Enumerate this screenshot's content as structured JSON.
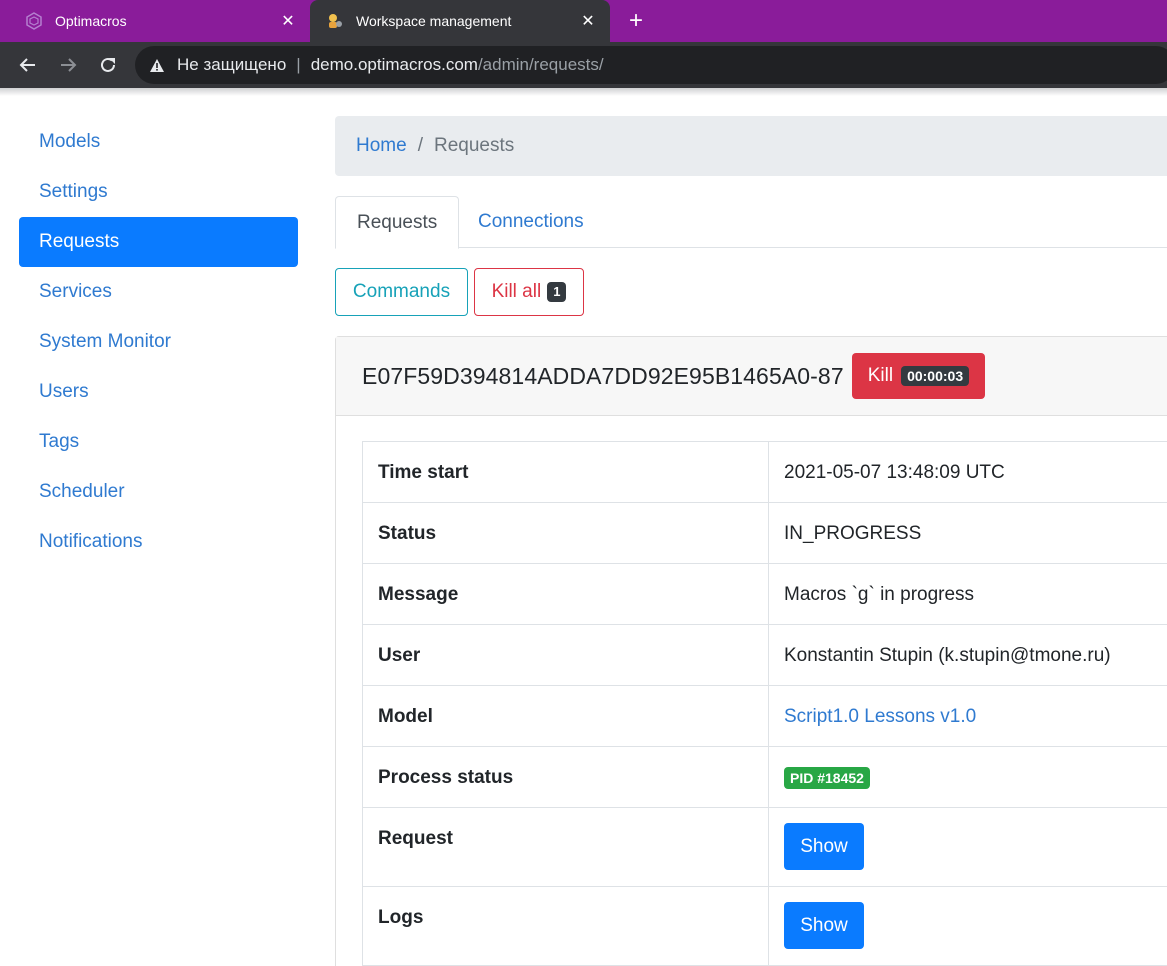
{
  "browser": {
    "tabs": [
      {
        "title": "Optimacros",
        "active": false
      },
      {
        "title": "Workspace management",
        "active": true
      }
    ],
    "address": {
      "security": "Не защищено",
      "host": "demo.optimacros.com",
      "path": "/admin/requests/"
    }
  },
  "sidebar": {
    "items": [
      {
        "label": "Models"
      },
      {
        "label": "Settings"
      },
      {
        "label": "Requests",
        "active": true
      },
      {
        "label": "Services"
      },
      {
        "label": "System Monitor"
      },
      {
        "label": "Users"
      },
      {
        "label": "Tags"
      },
      {
        "label": "Scheduler"
      },
      {
        "label": "Notifications"
      }
    ]
  },
  "breadcrumb": {
    "home": "Home",
    "separator": "/",
    "current": "Requests"
  },
  "tabs": [
    {
      "label": "Requests"
    },
    {
      "label": "Connections"
    }
  ],
  "actions": {
    "commands": "Commands",
    "kill_all": "Kill all",
    "kill_all_count": "1"
  },
  "request": {
    "id": "E07F59D394814ADDA7DD92E95B1465A0-87",
    "kill_label": "Kill",
    "elapsed": "00:00:03",
    "rows": [
      {
        "key": "Time start",
        "value": "2021-05-07 13:48:09 UTC"
      },
      {
        "key": "Status",
        "value": "IN_PROGRESS"
      },
      {
        "key": "Message",
        "value": "Macros `g` in progress"
      },
      {
        "key": "User",
        "value": "Konstantin Stupin (k.stupin@tmone.ru)"
      },
      {
        "key": "Model",
        "value": "Script1.0 Lessons v1.0"
      },
      {
        "key": "Process status",
        "value": "PID #18452"
      },
      {
        "key": "Request",
        "value": "Show"
      },
      {
        "key": "Logs",
        "value": "Show"
      }
    ]
  },
  "colors": {
    "tabstrip": "#8a1c9a",
    "primary": "#0a7bff",
    "danger": "#dc3545",
    "info": "#17a2b8",
    "success": "#28a745"
  }
}
